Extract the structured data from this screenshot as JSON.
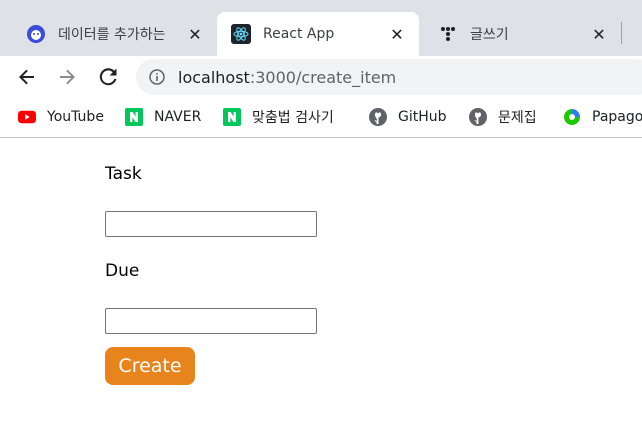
{
  "browser": {
    "tabs": [
      {
        "title": "데이터를 추가하는",
        "icon": "whale-icon",
        "active": false
      },
      {
        "title": "React App",
        "icon": "react-icon",
        "active": true
      },
      {
        "title": "글쓰기",
        "icon": "tistory-icon",
        "active": false
      }
    ],
    "address": {
      "host": "localhost",
      "path": ":3000/create_item"
    },
    "bookmarks": [
      {
        "label": "YouTube",
        "icon": "youtube-icon"
      },
      {
        "label": "NAVER",
        "icon": "naver-icon"
      },
      {
        "label": "맞춤법 검사기",
        "icon": "naver-icon"
      },
      {
        "label": "GitHub",
        "icon": "github-icon"
      },
      {
        "label": "문제집",
        "icon": "github-icon"
      },
      {
        "label": "Papago",
        "icon": "papago-icon"
      }
    ]
  },
  "form": {
    "task_label": "Task",
    "task_value": "",
    "due_label": "Due",
    "due_value": "",
    "create_label": "Create"
  },
  "colors": {
    "create_button": "#e8841c",
    "naver": "#03c75a",
    "youtube": "#ff0000",
    "tab_strip": "#dee1e6"
  }
}
